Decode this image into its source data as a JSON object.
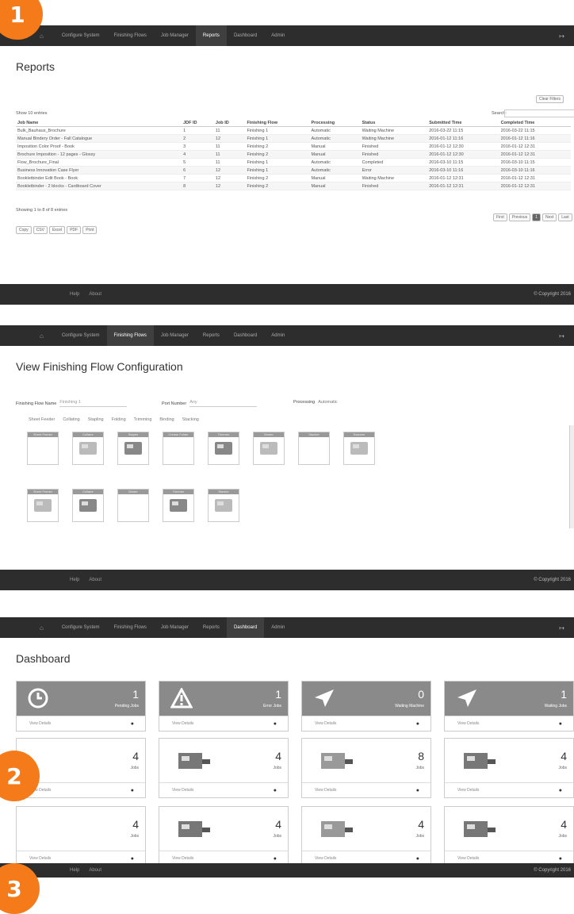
{
  "nav": {
    "home": "⌂",
    "items": [
      "Configure System",
      "Finishing Flows",
      "Job Manager",
      "Reports",
      "Dashboard",
      "Admin"
    ],
    "right": "↦"
  },
  "footer": {
    "help": "Help",
    "about": "About",
    "copyright": "© Copyright 2016"
  },
  "badges": [
    "1",
    "2",
    "3"
  ],
  "reports": {
    "title": "Reports",
    "show_entries": "Show 10 entries",
    "search": "Search:",
    "top_right_btn": "Clear Filters",
    "columns": [
      "Job Name",
      "JDF ID",
      "Job ID",
      "Finishing Flow",
      "Processing",
      "Status",
      "Submitted Time",
      "Completed Time"
    ],
    "rows": [
      [
        "Bulk_Bauhaus_Brochure",
        "1",
        "11",
        "Finishing 1",
        "Automatic",
        "Waiting Machine",
        "2016-03-22 11:15",
        "2016-03-22 11:15"
      ],
      [
        "Manual Bindery Order - Fall Catalogue",
        "2",
        "12",
        "Finishing 1",
        "Automatic",
        "Waiting Machine",
        "2016-01-12 11:16",
        "2016-01-12 11:16"
      ],
      [
        "Imposition Color Proof - Book",
        "3",
        "11",
        "Finishing 2",
        "Manual",
        "Finished",
        "2016-01-12 12:30",
        "2016-01-12 12:31"
      ],
      [
        "Brochure Imposition - 12 pages - Glossy",
        "4",
        "11",
        "Finishing 2",
        "Manual",
        "Finished",
        "2016-01-12 12:30",
        "2016-01-12 12:31"
      ],
      [
        "Flow_Brochure_Final",
        "5",
        "11",
        "Finishing 1",
        "Automatic",
        "Completed",
        "2016-03-10 11:15",
        "2016-03-10 11:15"
      ],
      [
        "Business Innovation Case Flyer",
        "6",
        "12",
        "Finishing 1",
        "Automatic",
        "Error",
        "2016-03-10 11:16",
        "2016-03-10 11:16"
      ],
      [
        "Bookletbinder Edit Book - Book",
        "7",
        "12",
        "Finishing 2",
        "Manual",
        "Waiting Machine",
        "2016-01-12 12:31",
        "2016-01-12 12:31"
      ],
      [
        "Bookletbinder - 2 blocks - Cardboard Cover",
        "8",
        "12",
        "Finishing 2",
        "Manual",
        "Finished",
        "2016-01-12 12:31",
        "2016-01-12 12:31"
      ]
    ],
    "info": "Showing 1 to 8 of 8 entries",
    "export_buttons": [
      "Copy",
      "CSV",
      "Excel",
      "PDF",
      "Print"
    ],
    "pager": [
      "First",
      "Previous",
      "1",
      "Next",
      "Last"
    ]
  },
  "flow": {
    "title": "View Finishing Flow Configuration",
    "name_label": "Finishing Flow Name",
    "name_value": "Finishing 1",
    "port_label": "Port Number",
    "port_value": "Any",
    "process_label": "Processing",
    "process_value": "Automatic",
    "legend": [
      "Sheet Feeder",
      "Collating",
      "Stapling",
      "Folding",
      "Trimming",
      "Binding",
      "Stacking"
    ],
    "row1": [
      "Sheet Feeder",
      "Collator",
      "Stapler",
      "Crease Folder",
      "Trimmer",
      "Binder",
      "Stacker",
      "Scanner"
    ],
    "row2": [
      "Sheet Feeder",
      "Collator",
      "Binder",
      "Trimmer",
      "Stacker"
    ]
  },
  "dash": {
    "title": "Dashboard",
    "stats": [
      {
        "num": "1",
        "label": "Pending Jobs",
        "icon": "clock-icon"
      },
      {
        "num": "1",
        "label": "Error Jobs",
        "icon": "warning-icon"
      },
      {
        "num": "0",
        "label": "Waiting Machine",
        "icon": "send-icon"
      },
      {
        "num": "1",
        "label": "Waiting Jobs",
        "icon": "send-icon"
      }
    ],
    "view_details": "View Details",
    "machines": [
      {
        "num": "4",
        "label": "Jobs"
      },
      {
        "num": "4",
        "label": "Jobs"
      },
      {
        "num": "8",
        "label": "Jobs"
      },
      {
        "num": "4",
        "label": "Jobs"
      },
      {
        "num": "4",
        "label": "Jobs"
      },
      {
        "num": "4",
        "label": "Jobs"
      },
      {
        "num": "4",
        "label": "Jobs"
      },
      {
        "num": "4",
        "label": "Jobs"
      }
    ]
  },
  "colors": {
    "accent": "#f57a19",
    "nav": "#2d2d2d",
    "stat_card": "#8a8a8a"
  }
}
